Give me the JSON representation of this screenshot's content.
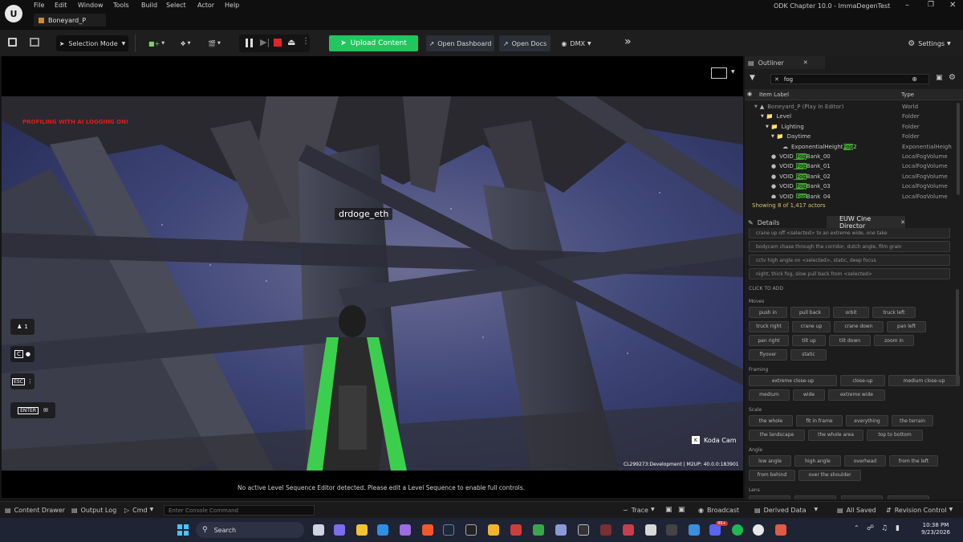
{
  "window": {
    "title": "Boneyard_P",
    "app_title": "ODK Chapter 10.0 - ImmaDegenTest"
  },
  "menu": [
    "File",
    "Edit",
    "Window",
    "Tools",
    "Build",
    "Select",
    "Actor",
    "Help"
  ],
  "toolbar": {
    "mode": "Selection Mode",
    "upload": "Upload Content",
    "dashboard": "Open Dashboard",
    "docs": "Open Docs",
    "dmx": "DMX",
    "settings": "Settings"
  },
  "viewport": {
    "warning": "PROFILING WITH AI LOGGING ON!",
    "player_name": "drdoge_eth",
    "player_count": "1",
    "mic_key": "C",
    "esc_key": "ESC",
    "enter_key": "ENTER",
    "camera": "Koda Cam",
    "build_info": "CL299273:Development | M2UP: 40.0.0:183901",
    "sequencer_msg": "No active Level Sequence Editor detected. Please edit a Level Sequence to enable full controls."
  },
  "outliner": {
    "title": "Outliner",
    "search": "fog",
    "col_label": "Item Label",
    "col_type": "Type",
    "rows": [
      {
        "pre": "Boneyard_P (Play In Editor)",
        "hl": "",
        "post": "",
        "type": "World"
      },
      {
        "pre": "Level",
        "hl": "",
        "post": "",
        "type": "Folder"
      },
      {
        "pre": "Lighting",
        "hl": "",
        "post": "",
        "type": "Folder"
      },
      {
        "pre": "Daytime",
        "hl": "",
        "post": "",
        "type": "Folder"
      },
      {
        "pre": "ExponentialHeight",
        "hl": "Fog",
        "post": "2",
        "type": "ExponentialHeight"
      },
      {
        "pre": "VOID_",
        "hl": "Fog",
        "post": "Bank_00",
        "type": "LocalFogVolume"
      },
      {
        "pre": "VOID_",
        "hl": "Fog",
        "post": "Bank_01",
        "type": "LocalFogVolume"
      },
      {
        "pre": "VOID_",
        "hl": "Fog",
        "post": "Bank_02",
        "type": "LocalFogVolume"
      },
      {
        "pre": "VOID_",
        "hl": "Fog",
        "post": "Bank_03",
        "type": "LocalFogVolume"
      },
      {
        "pre": "VOID_",
        "hl": "Fog",
        "post": "Bank_04",
        "type": "LocalFogVolume"
      }
    ],
    "status": "Showing 8 of 1,417 actors"
  },
  "tabs": {
    "details": "Details",
    "cine": "EUW Cine Director"
  },
  "cine": {
    "prompts": [
      "crane up off <selected> to an extreme wide, one take",
      "bodycam chase through the corridor, dutch angle, film grain",
      "cctv high angle on <selected>, static, deep focus",
      "night, thick fog, slow pull back from <selected>"
    ],
    "click_to_add": "CLICK TO ADD",
    "moves_title": "Moves",
    "moves": [
      "push in",
      "pull back",
      "orbit",
      "truck left",
      "truck right",
      "crane up",
      "crane down",
      "pan left",
      "pan right",
      "tilt up",
      "tilt down",
      "zoom in",
      "flyover",
      "static"
    ],
    "framing_title": "Framing",
    "framing": [
      "extreme close-up",
      "close-up",
      "medium close-up",
      "medium",
      "wide",
      "extreme wide"
    ],
    "scale_title": "Scale",
    "scale": [
      "the whole",
      "fit in frame",
      "everything",
      "the terrain",
      "the landscape",
      "the whole area",
      "top to bottom"
    ],
    "angle_title": "Angle",
    "angle": [
      "low angle",
      "high angle",
      "overhead",
      "from the left",
      "from behind",
      "over the shoulder"
    ],
    "lens_title": "Lens"
  },
  "status": {
    "drawer": "Content Drawer",
    "output": "Output Log",
    "cmd": "Cmd",
    "console_placeholder": "Enter Console Command",
    "trace": "Trace",
    "broadcast": "Broadcast",
    "derived": "Derived Data",
    "saved": "All Saved",
    "revision": "Revision Control"
  },
  "taskbar": {
    "search": "Search",
    "time": "10:38 PM",
    "date": "9/23/2026",
    "badge": "99+"
  }
}
